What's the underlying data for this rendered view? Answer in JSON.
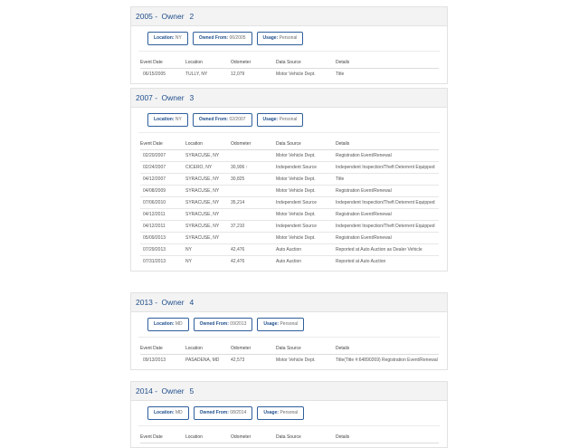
{
  "owners": [
    {
      "year": "2005",
      "label": "Owner",
      "num": "2",
      "location": "NY",
      "owned_from": "06/2005",
      "usage": "Personal",
      "rows": [
        [
          "06/15/2005",
          "TULLY, NY",
          "12,079",
          "Motor Vehicle Dept.",
          "Title"
        ]
      ]
    },
    {
      "year": "2007",
      "label": "Owner",
      "num": "3",
      "location": "NY",
      "owned_from": "02/2007",
      "usage": "Personal",
      "rows": [
        [
          "02/20/2007",
          "SYRACUSE, NY",
          "",
          "Motor Vehicle Dept.",
          "Registration Event/Renewal"
        ],
        [
          "02/24/2007",
          "CICERO, NY",
          "30,906 ↑",
          "Independent Source",
          "Independent Inspection/Theft Deterrent Equipped"
        ],
        [
          "04/12/2007",
          "SYRACUSE, NY",
          "30,825",
          "Motor Vehicle Dept.",
          "Title"
        ],
        [
          "04/08/2009",
          "SYRACUSE, NY",
          "",
          "Motor Vehicle Dept.",
          "Registration Event/Renewal"
        ],
        [
          "07/06/2010",
          "SYRACUSE, NY",
          "35,214",
          "Independent Source",
          "Independent Inspection/Theft Deterrent Equipped"
        ],
        [
          "04/12/2011",
          "SYRACUSE, NY",
          "",
          "Motor Vehicle Dept.",
          "Registration Event/Renewal"
        ],
        [
          "04/12/2011",
          "SYRACUSE, NY",
          "37,210",
          "Independent Source",
          "Independent Inspection/Theft Deterrent Equipped"
        ],
        [
          "05/09/2013",
          "SYRACUSE, NY",
          "",
          "Motor Vehicle Dept.",
          "Registration Event/Renewal"
        ],
        [
          "07/29/2013",
          "NY",
          "42,476",
          "Auto Auction",
          "Reported at Auto Auction as Dealer Vehicle"
        ],
        [
          "07/31/2013",
          "NY",
          "42,476",
          "Auto Auction",
          "Reported at Auto Auction"
        ]
      ]
    },
    {
      "year": "2013",
      "label": "Owner",
      "num": "4",
      "location": "MD",
      "owned_from": "09/2013",
      "usage": "Personal",
      "rows": [
        [
          "09/13/2013",
          "PASADENA, MD",
          "42,573",
          "Motor Vehicle Dept.",
          "Title(Title #:64890269) Registration Event/Renewal"
        ]
      ]
    },
    {
      "year": "2014",
      "label": "Owner",
      "num": "5",
      "location": "MD",
      "owned_from": "08/2014",
      "usage": "Personal",
      "rows": []
    }
  ],
  "labels": {
    "location": "Location:",
    "owned_from": "Owned From:",
    "usage": "Usage:"
  },
  "columns": [
    "Event Date",
    "Location",
    "Odometer",
    "Data Source",
    "Details"
  ],
  "colors": {
    "accent": "#1f4e8c",
    "header_bg": "#f3f3f3"
  }
}
